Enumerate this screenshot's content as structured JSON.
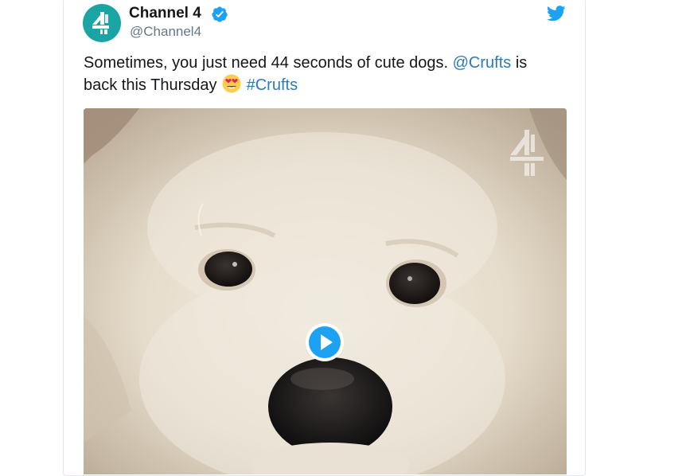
{
  "tweet": {
    "author_name": "Channel 4",
    "author_handle": "@Channel4",
    "text_part1": "Sometimes, you just need 44 seconds of cute dogs. ",
    "mention": "@Crufts",
    "text_part2": " is back this Thursday ",
    "emoji": "heart-eyes-emoji",
    "hashtag": "#Crufts"
  },
  "media": {
    "type": "video",
    "subject": "fluffy white dog close-up",
    "watermark": "channel-4-logo"
  },
  "icons": {
    "verified": "verified-badge-icon",
    "platform": "twitter-bird-icon",
    "play": "play-icon"
  },
  "colors": {
    "link": "#2b7bb9",
    "twitter_blue": "#1da1f2",
    "avatar_bg": "#1aa5a4",
    "text": "#14171a",
    "handle": "#657786"
  }
}
